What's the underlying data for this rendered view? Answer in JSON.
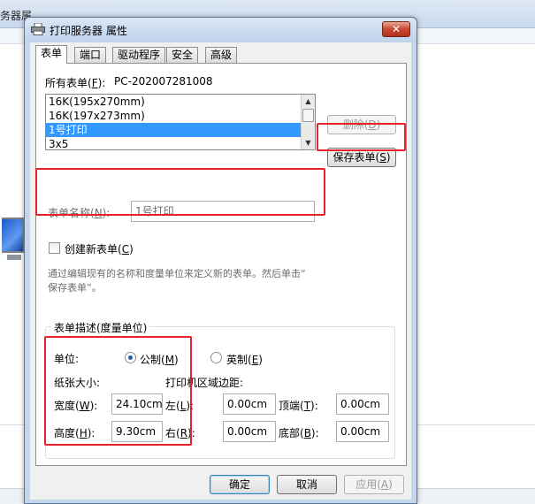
{
  "background": {
    "window_title_fragment": "务器属"
  },
  "dialog": {
    "title": "打印服务器 属性",
    "close_glyph": "✕",
    "tabs": [
      {
        "label": "表单"
      },
      {
        "label": "端口"
      },
      {
        "label": "驱动程序"
      },
      {
        "label": "安全"
      },
      {
        "label": "高级"
      }
    ],
    "forms_on": {
      "label": "所有表单(",
      "key": "F",
      "suffix": "):",
      "value": "PC-202007281008"
    },
    "form_list": {
      "items": [
        "16K(195x270mm)",
        "16K(197x273mm)",
        "1号打印",
        "3x5"
      ],
      "selected": "1号打印"
    },
    "delete_button": {
      "label": "删除(",
      "key": "D",
      "suffix": ")"
    },
    "save_form_button": {
      "label": "保存表单(",
      "key": "S",
      "suffix": ")"
    },
    "form_name": {
      "label": "表单名称(",
      "key": "N",
      "suffix": "):",
      "value": "1号打印"
    },
    "create_new": {
      "label": "创建新表单(",
      "key": "C",
      "suffix": ")",
      "checked": false
    },
    "hint_line1": "通过编辑现有的名称和度量单位来定义新的表单。然后单击“",
    "hint_line2": "保存表单”。",
    "description_group": {
      "title": "表单描述(度量单位)",
      "units_label": "单位:",
      "metric": {
        "label": "公制(",
        "key": "M",
        "suffix": ")",
        "selected": true
      },
      "english": {
        "label": "英制(",
        "key": "E",
        "suffix": ")",
        "selected": false
      },
      "paper_size_label": "纸张大小:",
      "margins_label": "打印机区域边距:",
      "width": {
        "label": "宽度(",
        "key": "W",
        "suffix": "):",
        "value": "24.10cm"
      },
      "height": {
        "label": "高度(",
        "key": "H",
        "suffix": "):",
        "value": "9.30cm"
      },
      "left": {
        "label": "左(",
        "key": "L",
        "suffix": "):",
        "value": "0.00cm"
      },
      "right": {
        "label": "右(",
        "key": "R",
        "suffix": "):",
        "value": "0.00cm"
      },
      "top": {
        "label": "顶端(",
        "key": "T",
        "suffix": "):",
        "value": "0.00cm"
      },
      "bottom": {
        "label": "底部(",
        "key": "B",
        "suffix": "):",
        "value": "0.00cm"
      }
    },
    "ok_button": {
      "label": "确定"
    },
    "cancel_button": {
      "label": "取消"
    },
    "apply_button": {
      "label": "应用(",
      "key": "A",
      "suffix": ")"
    }
  },
  "colors": {
    "highlight_border": "#e8222a",
    "selection": "#3399ff"
  }
}
